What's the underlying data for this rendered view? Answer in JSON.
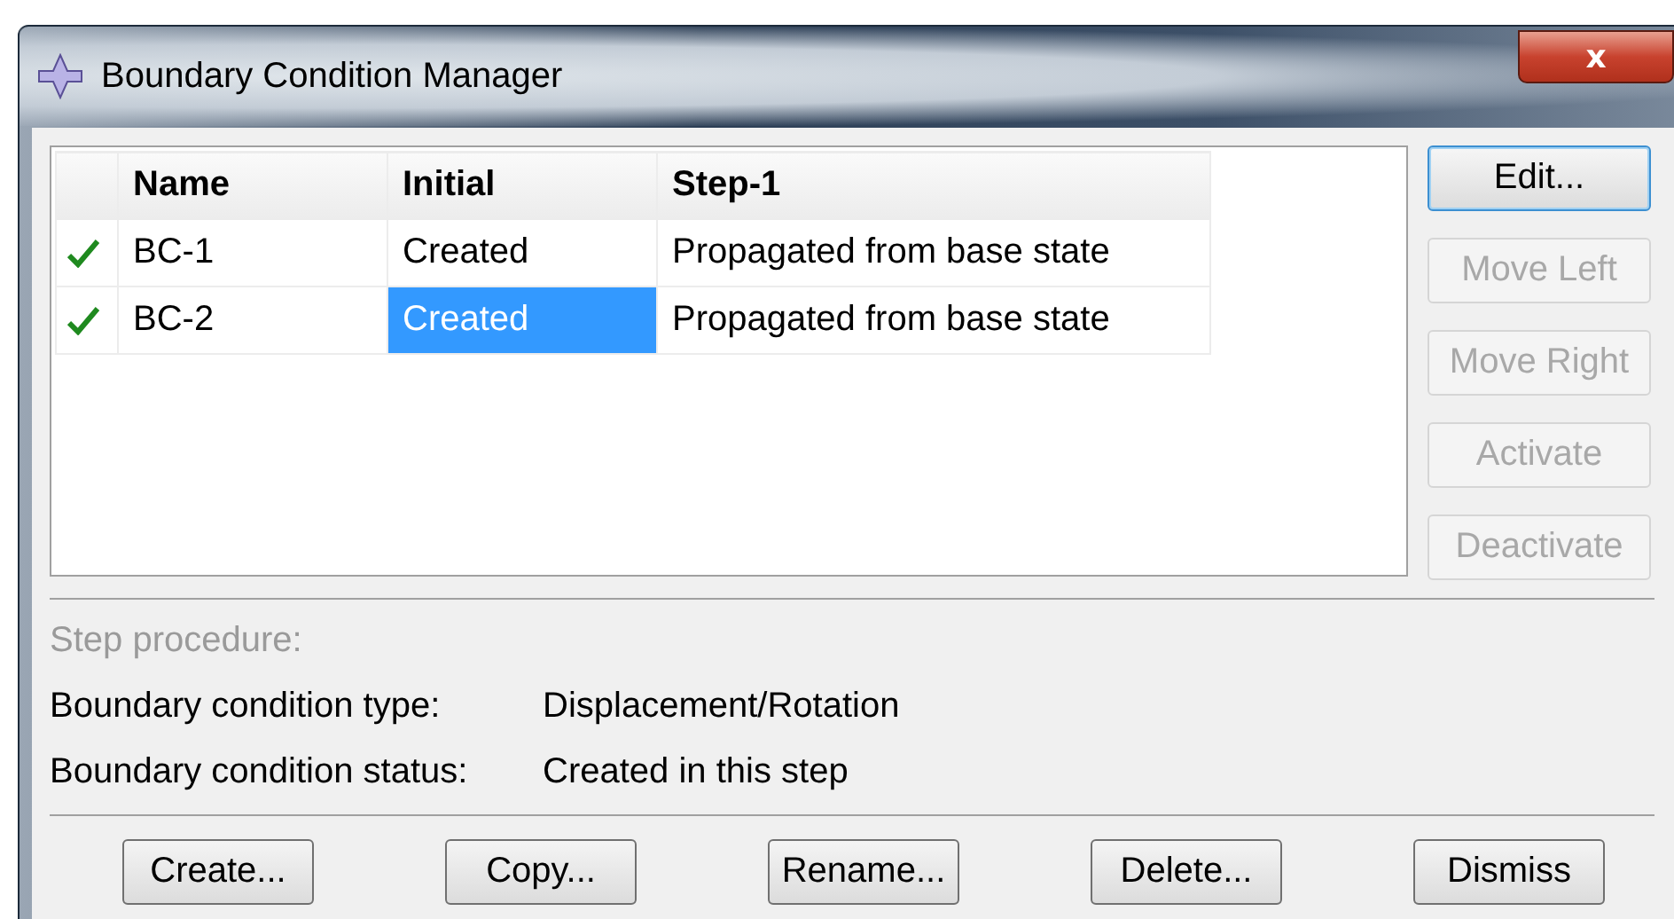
{
  "window": {
    "title": "Boundary Condition Manager",
    "close": "x"
  },
  "table": {
    "columns": [
      "Name",
      "Initial",
      "Step-1"
    ],
    "rows": [
      {
        "active": true,
        "cells": [
          {
            "text": "BC-1",
            "selected": false
          },
          {
            "text": "Created",
            "selected": false
          },
          {
            "text": "Propagated from base state",
            "selected": false
          }
        ]
      },
      {
        "active": true,
        "cells": [
          {
            "text": "BC-2",
            "selected": false
          },
          {
            "text": "Created",
            "selected": true
          },
          {
            "text": "Propagated from base state",
            "selected": false
          }
        ]
      }
    ]
  },
  "side_buttons": [
    {
      "label": "Edit...",
      "disabled": false
    },
    {
      "label": "Move Left",
      "disabled": true
    },
    {
      "label": "Move Right",
      "disabled": true
    },
    {
      "label": "Activate",
      "disabled": true
    },
    {
      "label": "Deactivate",
      "disabled": true
    }
  ],
  "info": {
    "step_procedure": {
      "label": "Step procedure:",
      "disabled": true
    },
    "lines": [
      {
        "label": "Boundary condition type:",
        "value": "Displacement/Rotation"
      },
      {
        "label": "Boundary condition status:",
        "value": "Created in this step"
      }
    ]
  },
  "buttons": [
    "Create...",
    "Copy...",
    "Rename...",
    "Delete...",
    "Dismiss"
  ]
}
